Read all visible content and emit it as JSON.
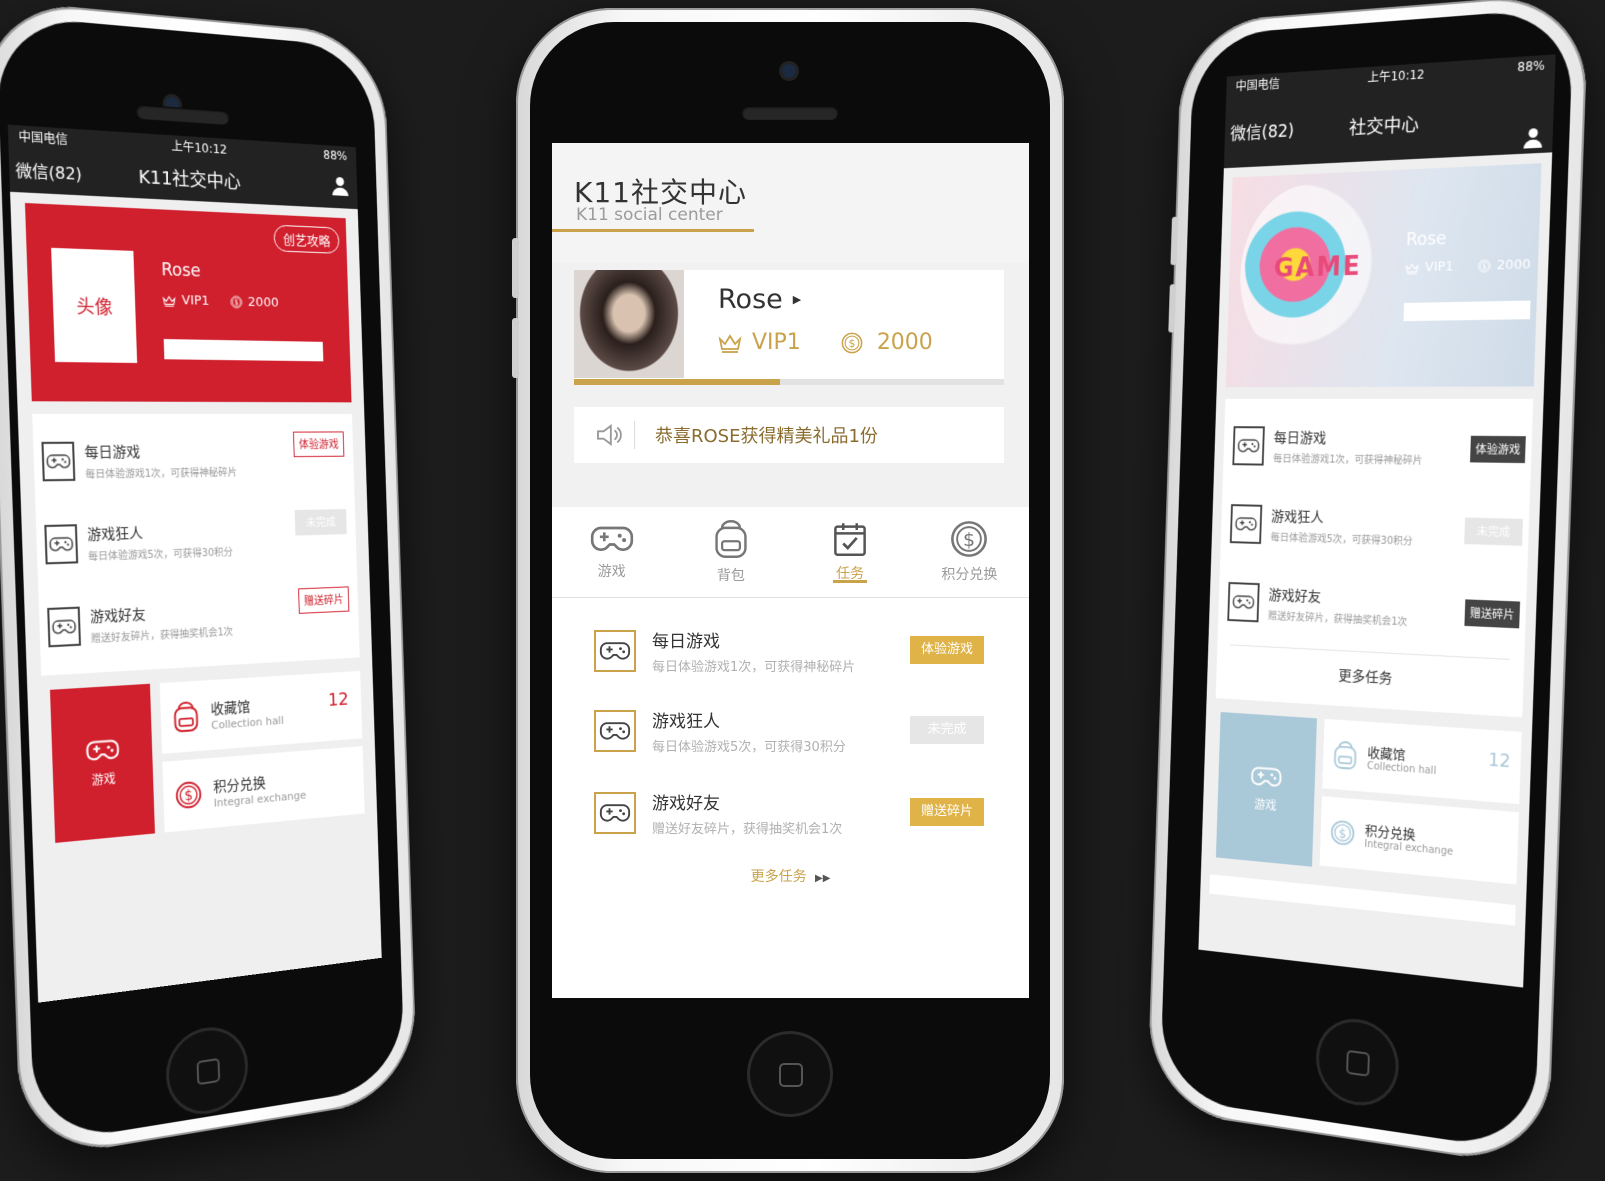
{
  "left": {
    "status": {
      "carrier": "中国电信",
      "time": "上午10:12",
      "battery": "88%"
    },
    "nav": {
      "back": "微信(82)",
      "title": "K11社交中心"
    },
    "badge": "创艺攻略",
    "avatar": "头像",
    "profile": {
      "name": "Rose",
      "vip": "VIP1",
      "points": "2000"
    },
    "tasks": [
      {
        "title": "每日游戏",
        "sub": "每日体验游戏1次，可获得神秘碎片",
        "button": "体验游戏"
      },
      {
        "title": "游戏狂人",
        "sub": "每日体验游戏5次，可获得30积分",
        "button": "未完成"
      },
      {
        "title": "游戏好友",
        "sub": "赠送好友碎片，获得抽奖机会1次",
        "button": "赠送碎片"
      }
    ],
    "game_tile": "游戏",
    "collection": {
      "title": "收藏馆",
      "sub": "Collection hall",
      "count": "12"
    },
    "exchange": {
      "title": "积分兑换",
      "sub": "Integral exchange"
    },
    "accent": "#d0202e"
  },
  "center": {
    "header": {
      "title": "K11社交中心",
      "subtitle": "K11 social center"
    },
    "profile": {
      "name": "Rose",
      "vip": "VIP1",
      "points": "2000"
    },
    "notice": "恭喜ROSE获得精美礼品1份",
    "tabs": [
      "游戏",
      "背包",
      "任务",
      "积分兑换"
    ],
    "tasks": [
      {
        "title": "每日游戏",
        "sub": "每日体验游戏1次，可获得神秘碎片",
        "button": "体验游戏"
      },
      {
        "title": "游戏狂人",
        "sub": "每日体验游戏5次，可获得30积分",
        "button": "未完成"
      },
      {
        "title": "游戏好友",
        "sub": "赠送好友碎片，获得抽奖机会1次",
        "button": "赠送碎片"
      }
    ],
    "more": "更多任务",
    "accent": "#c9a24a"
  },
  "right": {
    "status": {
      "carrier": "中国电信",
      "time": "上午10:12",
      "battery": "88%"
    },
    "nav": {
      "back": "微信(82)",
      "title": "社交中心"
    },
    "banner_text": "GAME",
    "profile": {
      "name": "Rose",
      "vip": "VIP1",
      "points": "2000"
    },
    "tasks": [
      {
        "title": "每日游戏",
        "sub": "每日体验游戏1次，可获得神秘碎片",
        "button": "体验游戏"
      },
      {
        "title": "游戏狂人",
        "sub": "每日体验游戏5次，可获得30积分",
        "button": "未完成"
      },
      {
        "title": "游戏好友",
        "sub": "赠送好友碎片，获得抽奖机会1次",
        "button": "赠送碎片"
      }
    ],
    "more": "更多任务",
    "game_tile": "游戏",
    "collection": {
      "title": "收藏馆",
      "sub": "Collection hall",
      "count": "12"
    },
    "exchange": {
      "title": "积分兑换",
      "sub": "Integral exchange"
    },
    "accent": "#a9c8d8"
  }
}
